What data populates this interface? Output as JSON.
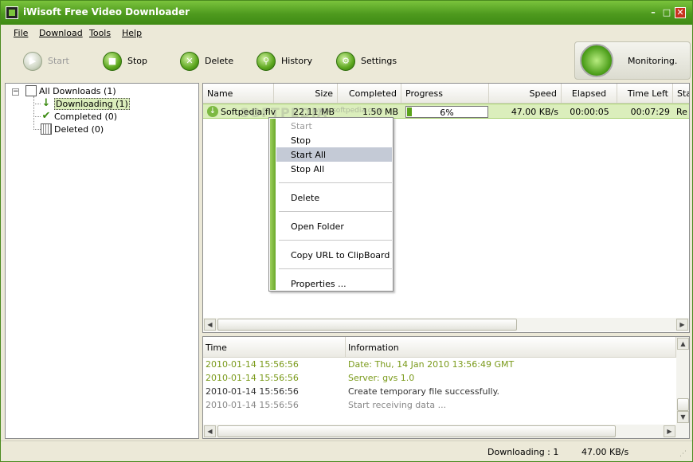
{
  "window": {
    "title": "iWisoft Free Video Downloader",
    "min": "–",
    "max": "□",
    "close": "✕"
  },
  "menu": [
    "File",
    "Download",
    "Tools",
    "Help"
  ],
  "toolbar": {
    "start": "Start",
    "stop": "Stop",
    "delete": "Delete",
    "history": "History",
    "settings": "Settings",
    "monitoring": "Monitoring."
  },
  "tree": {
    "root": "All Downloads (1)",
    "expander": "−",
    "items": [
      "Downloading (1)",
      "Completed (0)",
      "Deleted (0)"
    ]
  },
  "list": {
    "columns": [
      "Name",
      "Size",
      "Completed",
      "Progress",
      "Speed",
      "Elapsed",
      "Time Left",
      "Sta"
    ],
    "row": {
      "name": "Softpedia.flv",
      "size": "22.11 MB",
      "completed": "1.50 MB",
      "progress_text": "6%",
      "progress_fraction": 0.06,
      "speed": "47.00 KB/s",
      "elapsed": "00:00:05",
      "time_left": "00:07:29",
      "status": "Re"
    }
  },
  "context_menu": {
    "items": [
      "Start",
      "Stop",
      "Start All",
      "Stop All",
      "Delete",
      "Open Folder",
      "Copy URL to ClipBoard",
      "Properties ..."
    ],
    "disabled": [
      "Start"
    ],
    "highlighted": "Start All"
  },
  "log": {
    "columns": [
      "Time",
      "Information"
    ],
    "rows": [
      {
        "time": "2010-01-14 15:56:56",
        "info": "Date: Thu, 14 Jan 2010 13:56:49 GMT",
        "color": "#7a9a1a"
      },
      {
        "time": "2010-01-14 15:56:56",
        "info": "Server: gvs 1.0",
        "color": "#7a9a1a"
      },
      {
        "time": "2010-01-14 15:56:56",
        "info": "Create temporary file successfully.",
        "color": "#333333"
      },
      {
        "time": "2010-01-14 15:56:56",
        "info": "Start receiving data ...",
        "color": "#888888"
      }
    ]
  },
  "status": {
    "downloading": "Downloading : 1",
    "speed": "47.00 KB/s"
  },
  "watermark": "SOFTPEDIA",
  "watermark_url": "www.softpedia.com",
  "colors": {
    "accent": "#5aa31a",
    "row_bg": "#dbeebc",
    "title_bar": "#4e9a1e"
  }
}
